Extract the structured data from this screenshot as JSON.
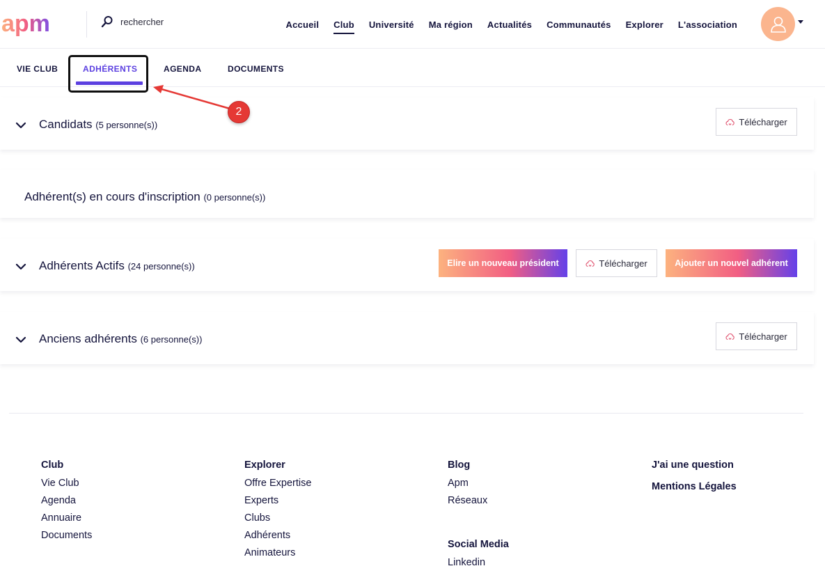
{
  "header": {
    "logo_text": "apm",
    "search_placeholder": "rechercher",
    "nav": [
      "Accueil",
      "Club",
      "Université",
      "Ma région",
      "Actualités",
      "Communautés",
      "Explorer",
      "L'association"
    ],
    "active_nav": "Club"
  },
  "tabs": {
    "items": [
      "VIE CLUB",
      "ADHÉRENTS",
      "AGENDA",
      "DOCUMENTS"
    ],
    "active": "ADHÉRENTS"
  },
  "annotation": {
    "step": "2"
  },
  "sections": {
    "candidats": {
      "title": "Candidats",
      "count": "(5 personne(s))",
      "download": "Télécharger"
    },
    "en_cours": {
      "title": "Adhérent(s) en cours d'inscription",
      "count": "(0 personne(s))"
    },
    "actifs": {
      "title": "Adhérents Actifs",
      "count": "(24 personne(s))",
      "elect": "Elire un nouveau président",
      "download": "Télécharger",
      "add": "Ajouter un nouvel adhérent"
    },
    "anciens": {
      "title": "Anciens adhérents",
      "count": "(6 personne(s))",
      "download": "Télécharger"
    }
  },
  "footer": {
    "club": {
      "title": "Club",
      "links": [
        "Vie Club",
        "Agenda",
        "Annuaire",
        "Documents"
      ]
    },
    "explorer": {
      "title": "Explorer",
      "links": [
        "Offre Expertise",
        "Experts",
        "Clubs",
        "Adhérents",
        "Animateurs"
      ]
    },
    "blog": {
      "title": "Blog",
      "links": [
        "Apm",
        "Réseaux"
      ]
    },
    "social": {
      "title": "Social Media",
      "links": [
        "Linkedin"
      ]
    },
    "question": "J'ai une question",
    "legal": "Mentions Légales"
  },
  "colors": {
    "accent": "#5b3fe0",
    "avatar": "#fbb58e",
    "annotation": "#e53935"
  }
}
